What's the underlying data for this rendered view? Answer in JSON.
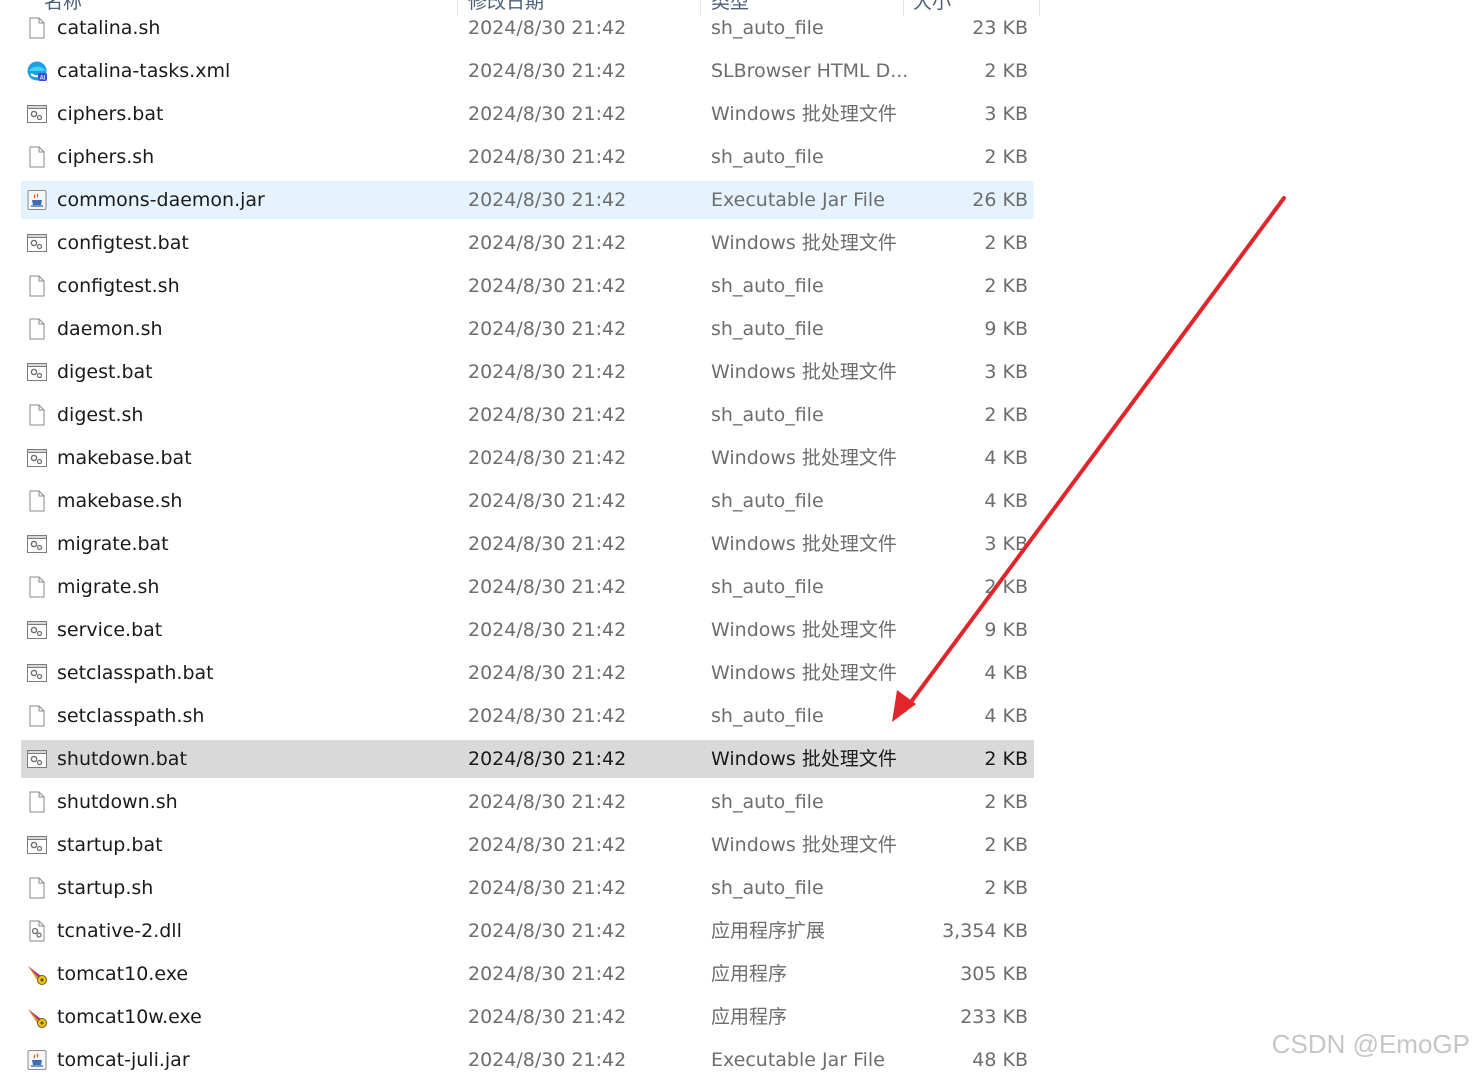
{
  "header": {
    "name": "名称",
    "date": "修改日期",
    "type": "类型",
    "size": "大小"
  },
  "files": [
    {
      "name": "catalina.sh",
      "date": "2024/8/30 21:42",
      "type": "sh_auto_file",
      "size": "23 KB",
      "icon": "blank-file-icon"
    },
    {
      "name": "catalina-tasks.xml",
      "date": "2024/8/30 21:42",
      "type": "SLBrowser HTML D...",
      "size": "2 KB",
      "icon": "browser-file-icon"
    },
    {
      "name": "ciphers.bat",
      "date": "2024/8/30 21:42",
      "type": "Windows 批处理文件",
      "size": "3 KB",
      "icon": "batch-file-icon"
    },
    {
      "name": "ciphers.sh",
      "date": "2024/8/30 21:42",
      "type": "sh_auto_file",
      "size": "2 KB",
      "icon": "blank-file-icon"
    },
    {
      "name": "commons-daemon.jar",
      "date": "2024/8/30 21:42",
      "type": "Executable Jar File",
      "size": "26 KB",
      "icon": "jar-file-icon",
      "state": "hover"
    },
    {
      "name": "configtest.bat",
      "date": "2024/8/30 21:42",
      "type": "Windows 批处理文件",
      "size": "2 KB",
      "icon": "batch-file-icon"
    },
    {
      "name": "configtest.sh",
      "date": "2024/8/30 21:42",
      "type": "sh_auto_file",
      "size": "2 KB",
      "icon": "blank-file-icon"
    },
    {
      "name": "daemon.sh",
      "date": "2024/8/30 21:42",
      "type": "sh_auto_file",
      "size": "9 KB",
      "icon": "blank-file-icon"
    },
    {
      "name": "digest.bat",
      "date": "2024/8/30 21:42",
      "type": "Windows 批处理文件",
      "size": "3 KB",
      "icon": "batch-file-icon"
    },
    {
      "name": "digest.sh",
      "date": "2024/8/30 21:42",
      "type": "sh_auto_file",
      "size": "2 KB",
      "icon": "blank-file-icon"
    },
    {
      "name": "makebase.bat",
      "date": "2024/8/30 21:42",
      "type": "Windows 批处理文件",
      "size": "4 KB",
      "icon": "batch-file-icon"
    },
    {
      "name": "makebase.sh",
      "date": "2024/8/30 21:42",
      "type": "sh_auto_file",
      "size": "4 KB",
      "icon": "blank-file-icon"
    },
    {
      "name": "migrate.bat",
      "date": "2024/8/30 21:42",
      "type": "Windows 批处理文件",
      "size": "3 KB",
      "icon": "batch-file-icon"
    },
    {
      "name": "migrate.sh",
      "date": "2024/8/30 21:42",
      "type": "sh_auto_file",
      "size": "2 KB",
      "icon": "blank-file-icon"
    },
    {
      "name": "service.bat",
      "date": "2024/8/30 21:42",
      "type": "Windows 批处理文件",
      "size": "9 KB",
      "icon": "batch-file-icon"
    },
    {
      "name": "setclasspath.bat",
      "date": "2024/8/30 21:42",
      "type": "Windows 批处理文件",
      "size": "4 KB",
      "icon": "batch-file-icon"
    },
    {
      "name": "setclasspath.sh",
      "date": "2024/8/30 21:42",
      "type": "sh_auto_file",
      "size": "4 KB",
      "icon": "blank-file-icon"
    },
    {
      "name": "shutdown.bat",
      "date": "2024/8/30 21:42",
      "type": "Windows 批处理文件",
      "size": "2 KB",
      "icon": "batch-file-icon",
      "state": "selected"
    },
    {
      "name": "shutdown.sh",
      "date": "2024/8/30 21:42",
      "type": "sh_auto_file",
      "size": "2 KB",
      "icon": "blank-file-icon"
    },
    {
      "name": "startup.bat",
      "date": "2024/8/30 21:42",
      "type": "Windows 批处理文件",
      "size": "2 KB",
      "icon": "batch-file-icon"
    },
    {
      "name": "startup.sh",
      "date": "2024/8/30 21:42",
      "type": "sh_auto_file",
      "size": "2 KB",
      "icon": "blank-file-icon"
    },
    {
      "name": "tcnative-2.dll",
      "date": "2024/8/30 21:42",
      "type": "应用程序扩展",
      "size": "3,354 KB",
      "icon": "dll-file-icon"
    },
    {
      "name": "tomcat10.exe",
      "date": "2024/8/30 21:42",
      "type": "应用程序",
      "size": "305 KB",
      "icon": "tomcat-exe-icon"
    },
    {
      "name": "tomcat10w.exe",
      "date": "2024/8/30 21:42",
      "type": "应用程序",
      "size": "233 KB",
      "icon": "tomcat-exe-icon"
    },
    {
      "name": "tomcat-juli.jar",
      "date": "2024/8/30 21:42",
      "type": "Executable Jar File",
      "size": "48 KB",
      "icon": "jar-file-icon"
    }
  ],
  "annotation": {
    "arrow_color": "#e0262b"
  },
  "colors": {
    "hover_row": "#e5f3ff",
    "selected_row": "#d9d9d9"
  },
  "watermark": "CSDN @EmoGP"
}
